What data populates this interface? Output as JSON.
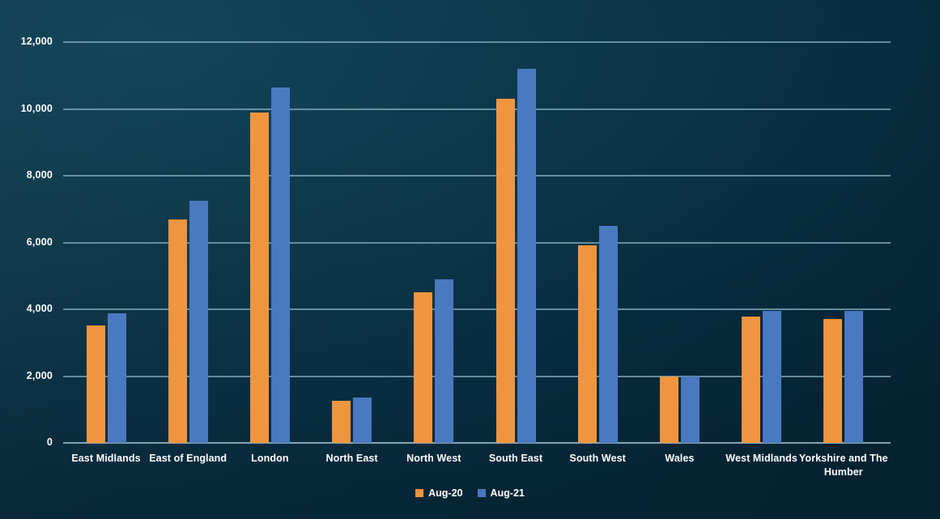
{
  "chart_data": {
    "type": "bar",
    "title": "",
    "subtitle": "",
    "xlabel": "",
    "ylabel": "",
    "ylim": [
      0,
      12000
    ],
    "yticks": [
      "0",
      "2,000",
      "4,000",
      "6,000",
      "8,000",
      "10,000",
      "12,000"
    ],
    "ytick_values": [
      0,
      2000,
      4000,
      6000,
      8000,
      10000,
      12000
    ],
    "grid": true,
    "legend_position": "bottom",
    "categories": [
      "East Midlands",
      "East of England",
      "London",
      "North East",
      "North West",
      "South East",
      "South West",
      "Wales",
      "West Midlands",
      "Yorkshire and The Humber"
    ],
    "series": [
      {
        "name": "Aug-20",
        "color": "#f0953f",
        "values": [
          3520,
          6680,
          9880,
          1250,
          4500,
          10300,
          5920,
          1980,
          3790,
          3720
        ]
      },
      {
        "name": "Aug-21",
        "color": "#4a79c0",
        "values": [
          3880,
          7260,
          10650,
          1350,
          4900,
          11200,
          6500,
          2000,
          3960,
          3950
        ]
      }
    ]
  },
  "colors": {
    "background": "#0c3749",
    "gridline": "#7fa8bb",
    "text": "#ffffff",
    "series_aug20": "#f0953f",
    "series_aug21": "#4a79c0"
  },
  "legend": {
    "items": [
      {
        "label": "Aug-20"
      },
      {
        "label": "Aug-21"
      }
    ]
  }
}
